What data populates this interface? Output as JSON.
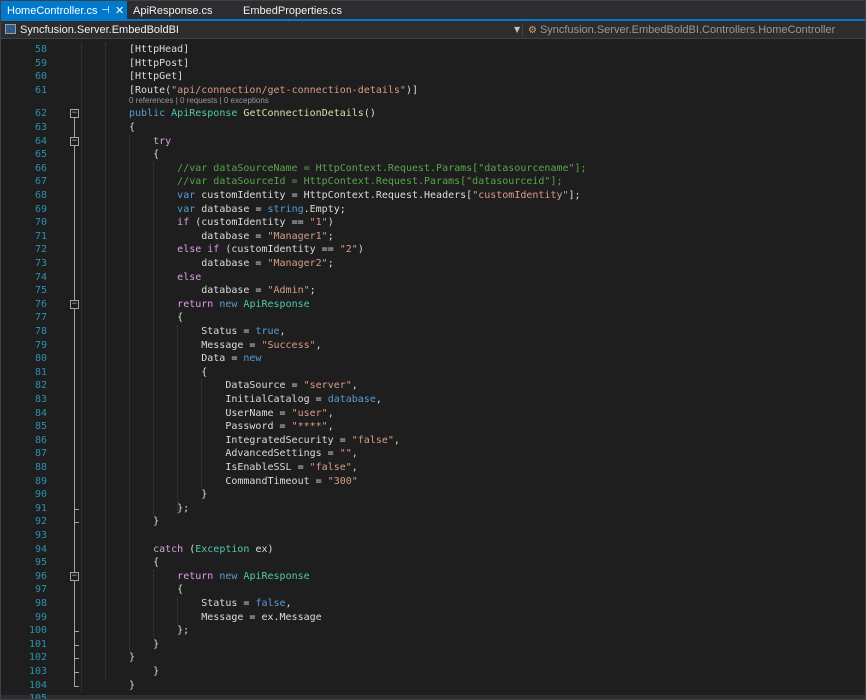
{
  "tabs": [
    {
      "label": "HomeController.cs",
      "active": true,
      "pinned": true
    },
    {
      "label": "ApiResponse.cs",
      "active": false
    },
    {
      "label": "EmbedProperties.cs",
      "active": false
    }
  ],
  "navbar": {
    "project": "Syncfusion.Server.EmbedBoldBI",
    "member": "Syncfusion.Server.EmbedBoldBI.Controllers.HomeController"
  },
  "code_lens": "0 references | 0 requests | 0 exceptions",
  "colors": {
    "accent": "#007acc",
    "keyword": "#569cd6",
    "type": "#4ec9b0",
    "string": "#d69d85",
    "comment": "#57a64a",
    "control": "#d8a0df",
    "line_number": "#2b91af"
  },
  "lines": [
    {
      "n": "58",
      "segs": [
        [
          "p",
          "[HttpHead]"
        ]
      ]
    },
    {
      "n": "59",
      "segs": [
        [
          "p",
          "[HttpPost]"
        ]
      ]
    },
    {
      "n": "60",
      "segs": [
        [
          "p",
          "[HttpGet]"
        ]
      ]
    },
    {
      "n": "61",
      "segs": [
        [
          "p",
          "[Route("
        ],
        [
          "s",
          "\"api/connection/get-connection-details\""
        ],
        [
          "p",
          ")]"
        ]
      ]
    },
    {
      "n": "62",
      "segs": [
        [
          "k",
          "public "
        ],
        [
          "t",
          "ApiResponse"
        ],
        [
          "p",
          " "
        ],
        [
          "m",
          "GetConnectionDetails"
        ],
        [
          "p",
          "()"
        ]
      ]
    },
    {
      "n": "63",
      "segs": [
        [
          "p",
          "{"
        ]
      ]
    },
    {
      "n": "64",
      "segs": [
        [
          "p",
          "    "
        ],
        [
          "ctl",
          "try"
        ]
      ]
    },
    {
      "n": "65",
      "segs": [
        [
          "p",
          "    {"
        ]
      ]
    },
    {
      "n": "66",
      "segs": [
        [
          "p",
          "        "
        ],
        [
          "c",
          "//var dataSourceName = HttpContext.Request.Params[\"datasourcename\"];"
        ]
      ]
    },
    {
      "n": "67",
      "segs": [
        [
          "p",
          "        "
        ],
        [
          "c",
          "//var dataSourceId = HttpContext.Request.Params[\"datasourceid\"];"
        ]
      ]
    },
    {
      "n": "68",
      "segs": [
        [
          "p",
          "        "
        ],
        [
          "k",
          "var"
        ],
        [
          "p",
          " customIdentity = HttpContext.Request.Headers["
        ],
        [
          "s",
          "\"customIdentity\""
        ],
        [
          "p",
          "];"
        ]
      ]
    },
    {
      "n": "69",
      "segs": [
        [
          "p",
          "        "
        ],
        [
          "k",
          "var"
        ],
        [
          "p",
          " database = "
        ],
        [
          "k",
          "string"
        ],
        [
          "p",
          ".Empty;"
        ]
      ]
    },
    {
      "n": "70",
      "segs": [
        [
          "p",
          "        "
        ],
        [
          "ctl",
          "if"
        ],
        [
          "p",
          " (customIdentity == "
        ],
        [
          "s",
          "\"1\""
        ],
        [
          "p",
          ")"
        ]
      ]
    },
    {
      "n": "71",
      "segs": [
        [
          "p",
          "            database = "
        ],
        [
          "s",
          "\"Manager1\""
        ],
        [
          "p",
          ";"
        ]
      ]
    },
    {
      "n": "72",
      "segs": [
        [
          "p",
          "        "
        ],
        [
          "ctl",
          "else if"
        ],
        [
          "p",
          " (customIdentity == "
        ],
        [
          "s",
          "\"2\""
        ],
        [
          "p",
          ")"
        ]
      ]
    },
    {
      "n": "73",
      "segs": [
        [
          "p",
          "            database = "
        ],
        [
          "s",
          "\"Manager2\""
        ],
        [
          "p",
          ";"
        ]
      ]
    },
    {
      "n": "74",
      "segs": [
        [
          "p",
          "        "
        ],
        [
          "ctl",
          "else"
        ]
      ]
    },
    {
      "n": "75",
      "segs": [
        [
          "p",
          "            database = "
        ],
        [
          "s",
          "\"Admin\""
        ],
        [
          "p",
          ";"
        ]
      ]
    },
    {
      "n": "76",
      "segs": [
        [
          "p",
          "        "
        ],
        [
          "ctl",
          "return"
        ],
        [
          "p",
          " "
        ],
        [
          "k",
          "new"
        ],
        [
          "p",
          " "
        ],
        [
          "t",
          "ApiResponse"
        ]
      ]
    },
    {
      "n": "77",
      "segs": [
        [
          "p",
          "        {"
        ]
      ]
    },
    {
      "n": "78",
      "segs": [
        [
          "p",
          "            Status = "
        ],
        [
          "k",
          "true"
        ],
        [
          "p",
          ","
        ]
      ]
    },
    {
      "n": "79",
      "segs": [
        [
          "p",
          "            Message = "
        ],
        [
          "s",
          "\"Success\""
        ],
        [
          "p",
          ","
        ]
      ]
    },
    {
      "n": "80",
      "segs": [
        [
          "p",
          "            Data = "
        ],
        [
          "k",
          "new"
        ]
      ]
    },
    {
      "n": "81",
      "segs": [
        [
          "p",
          "            {"
        ]
      ]
    },
    {
      "n": "82",
      "segs": [
        [
          "p",
          "                DataSource = "
        ],
        [
          "s",
          "\"server\""
        ],
        [
          "p",
          ","
        ]
      ]
    },
    {
      "n": "83",
      "segs": [
        [
          "p",
          "                InitialCatalog = "
        ],
        [
          "k",
          "database"
        ],
        [
          "p",
          ","
        ]
      ]
    },
    {
      "n": "84",
      "segs": [
        [
          "p",
          "                UserName = "
        ],
        [
          "s",
          "\"user\""
        ],
        [
          "p",
          ","
        ]
      ]
    },
    {
      "n": "85",
      "segs": [
        [
          "p",
          "                Password = "
        ],
        [
          "s",
          "\"****\""
        ],
        [
          "p",
          ","
        ]
      ]
    },
    {
      "n": "86",
      "segs": [
        [
          "p",
          "                IntegratedSecurity = "
        ],
        [
          "s",
          "\"false\""
        ],
        [
          "p",
          ","
        ]
      ]
    },
    {
      "n": "87",
      "segs": [
        [
          "p",
          "                AdvancedSettings = "
        ],
        [
          "s",
          "\"\""
        ],
        [
          "p",
          ","
        ]
      ]
    },
    {
      "n": "88",
      "segs": [
        [
          "p",
          "                IsEnableSSL = "
        ],
        [
          "s",
          "\"false\""
        ],
        [
          "p",
          ","
        ]
      ]
    },
    {
      "n": "89",
      "segs": [
        [
          "p",
          "                CommandTimeout = "
        ],
        [
          "s",
          "\"300\""
        ]
      ]
    },
    {
      "n": "90",
      "segs": [
        [
          "p",
          "            }"
        ]
      ]
    },
    {
      "n": "91",
      "segs": [
        [
          "p",
          "        };"
        ]
      ]
    },
    {
      "n": "92",
      "segs": [
        [
          "p",
          "    }"
        ]
      ]
    },
    {
      "n": "93",
      "segs": []
    },
    {
      "n": "94",
      "segs": [
        [
          "p",
          "    "
        ],
        [
          "ctl",
          "catch"
        ],
        [
          "p",
          " ("
        ],
        [
          "t",
          "Exception"
        ],
        [
          "p",
          " ex)"
        ]
      ]
    },
    {
      "n": "95",
      "segs": [
        [
          "p",
          "    {"
        ]
      ]
    },
    {
      "n": "96",
      "segs": [
        [
          "p",
          "        "
        ],
        [
          "ctl",
          "return"
        ],
        [
          "p",
          " "
        ],
        [
          "k",
          "new"
        ],
        [
          "p",
          " "
        ],
        [
          "t",
          "ApiResponse"
        ]
      ]
    },
    {
      "n": "97",
      "segs": [
        [
          "p",
          "        {"
        ]
      ]
    },
    {
      "n": "98",
      "segs": [
        [
          "p",
          "            Status = "
        ],
        [
          "k",
          "false"
        ],
        [
          "p",
          ","
        ]
      ]
    },
    {
      "n": "99",
      "segs": [
        [
          "p",
          "            Message = ex.Message"
        ]
      ]
    },
    {
      "n": "100",
      "segs": [
        [
          "p",
          "        };"
        ]
      ]
    },
    {
      "n": "101",
      "segs": [
        [
          "p",
          "    }"
        ]
      ]
    },
    {
      "n": "102",
      "segs": [
        [
          "p",
          "}"
        ]
      ]
    },
    {
      "n": "103",
      "segs": [
        [
          "p",
          "    }"
        ]
      ]
    },
    {
      "n": "104",
      "segs": [
        [
          "p",
          "}"
        ]
      ]
    },
    {
      "n": "105",
      "segs": []
    }
  ]
}
